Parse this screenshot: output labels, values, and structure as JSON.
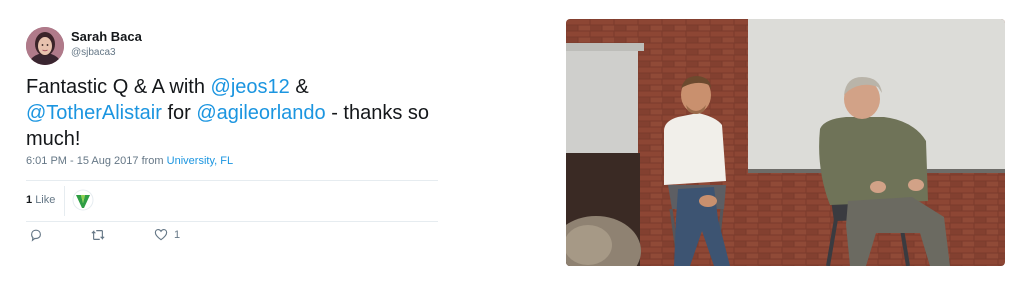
{
  "tweet": {
    "author": {
      "name": "Sarah Baca",
      "handle": "@sjbaca3",
      "avatar_icon": "avatar-photo"
    },
    "text": {
      "part1": "Fantastic Q & A with ",
      "mention1": "@jeos12",
      "part2": " & ",
      "mention2": "@TotherAlistair",
      "part3": " for ",
      "mention3": "@agileorlando",
      "part4": " - thanks so much!"
    },
    "timestamp": "6:01 PM - 15 Aug 2017",
    "from_label": " from ",
    "place": "University, FL",
    "likes": {
      "count": "1",
      "label": "Like",
      "liker_icon": "liker-avatar-icon"
    },
    "actions": {
      "reply_icon": "reply-icon",
      "retweet_icon": "retweet-icon",
      "like_icon": "heart-icon",
      "like_count": "1"
    },
    "media": {
      "description_icon": "attached-photo"
    },
    "colors": {
      "link": "#1b95e0",
      "text": "#14171a",
      "muted": "#657786",
      "divider": "#e6ecf0"
    }
  }
}
